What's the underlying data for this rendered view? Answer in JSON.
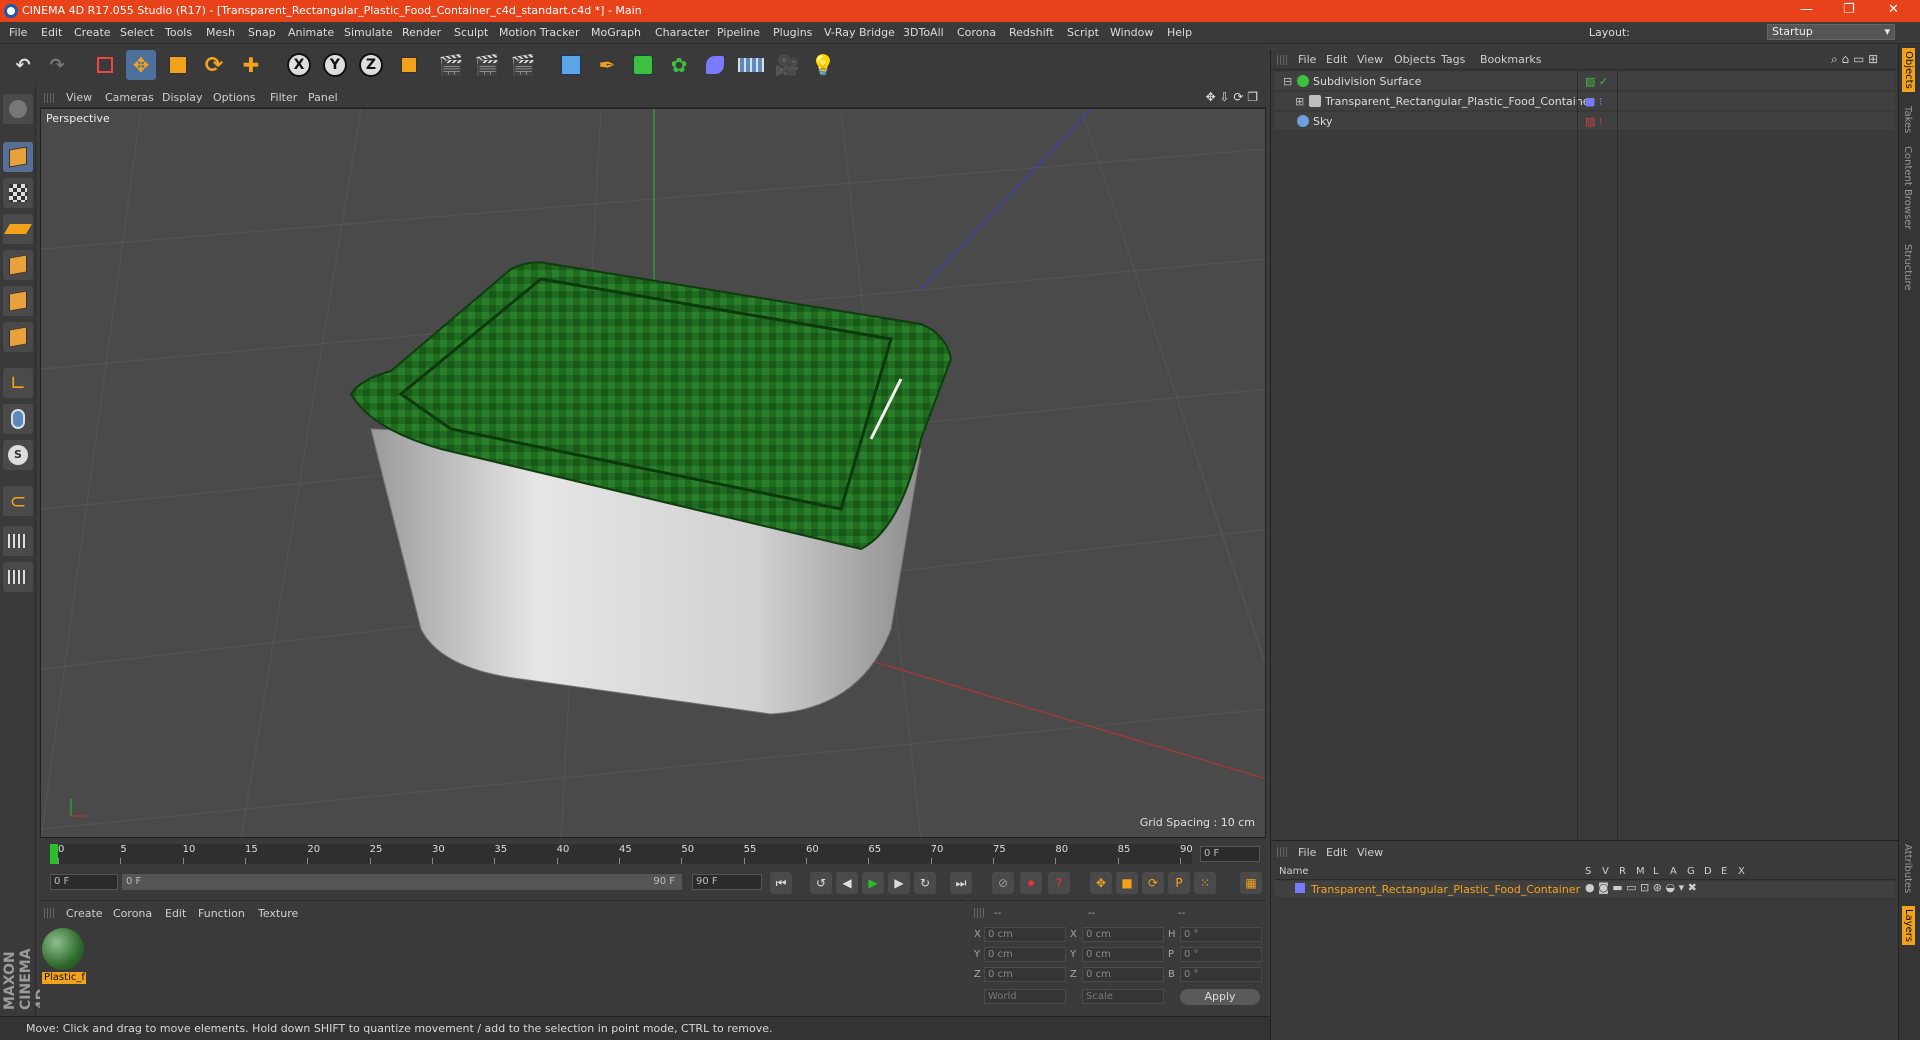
{
  "titlebar": {
    "title": "CINEMA 4D R17.055 Studio (R17) - [Transparent_Rectangular_Plastic_Food_Container_c4d_standart.c4d *] - Main",
    "min": "—",
    "max": "❐",
    "close": "✕"
  },
  "menu": [
    "File",
    "Edit",
    "Create",
    "Select",
    "Tools",
    "Mesh",
    "Snap",
    "Animate",
    "Simulate",
    "Render",
    "Sculpt",
    "Motion Tracker",
    "MoGraph",
    "Character",
    "Pipeline",
    "Plugins",
    "V-Ray Bridge",
    "3DToAll",
    "Corona",
    "Redshift",
    "Script",
    "Window",
    "Help"
  ],
  "layout": {
    "label": "Layout:",
    "value": "Startup"
  },
  "axis_buttons": [
    "X",
    "Y",
    "Z"
  ],
  "viewport": {
    "menu": [
      "View",
      "Cameras",
      "Display",
      "Options",
      "Filter",
      "Panel"
    ],
    "label": "Perspective",
    "grid_spacing": "Grid Spacing : 10 cm"
  },
  "timeline": {
    "ticks": [
      "0",
      "5",
      "10",
      "15",
      "20",
      "25",
      "30",
      "35",
      "40",
      "45",
      "50",
      "55",
      "60",
      "65",
      "70",
      "75",
      "80",
      "85",
      "90"
    ],
    "current_frame": "0 F",
    "start_frame": "0 F",
    "range_start": "0 F",
    "range_end": "90 F",
    "end_frame": "90 F"
  },
  "material_manager": {
    "menu": [
      "Create",
      "Corona",
      "Edit",
      "Function",
      "Texture"
    ],
    "materials": [
      {
        "name": "Plastic_f"
      }
    ]
  },
  "coords": {
    "headers": [
      "--",
      "--",
      "--"
    ],
    "rows": [
      {
        "a": "X",
        "av": "0 cm",
        "b": "X",
        "bv": "0 cm",
        "c": "H",
        "cv": "0 °"
      },
      {
        "a": "Y",
        "av": "0 cm",
        "b": "Y",
        "bv": "0 cm",
        "c": "P",
        "cv": "0 °"
      },
      {
        "a": "Z",
        "av": "0 cm",
        "b": "Z",
        "bv": "0 cm",
        "c": "B",
        "cv": "0 °"
      }
    ],
    "mode1": "World",
    "mode2": "Scale",
    "apply": "Apply"
  },
  "status": "Move: Click and drag to move elements. Hold down SHIFT to quantize movement / add to the selection in point mode, CTRL to remove.",
  "object_manager": {
    "menu": [
      "File",
      "Edit",
      "View",
      "Objects",
      "Tags",
      "Bookmarks"
    ],
    "objects": [
      {
        "name": "Subdivision Surface",
        "color": "#3fbf3f"
      },
      {
        "name": "Transparent_Rectangular_Plastic_Food_Container",
        "color": "#bdbdbd"
      },
      {
        "name": "Sky",
        "color": "#6f9fdf"
      }
    ]
  },
  "attribute_manager": {
    "menu": [
      "File",
      "Edit",
      "View"
    ],
    "columns": [
      "Name",
      "S",
      "V",
      "R",
      "M",
      "L",
      "A",
      "G",
      "D",
      "E",
      "X"
    ],
    "row_name": "Transparent_Rectangular_Plastic_Food_Container"
  },
  "sidetabs": [
    "Objects",
    "Takes",
    "Content Browser",
    "Structure",
    "Attributes",
    "Layers"
  ],
  "colors": {
    "title_bar": "#e8421b",
    "accent_selected": "#4c6f9b",
    "material_label": "#f2a31b",
    "lid_green": "#1f6b1f"
  }
}
